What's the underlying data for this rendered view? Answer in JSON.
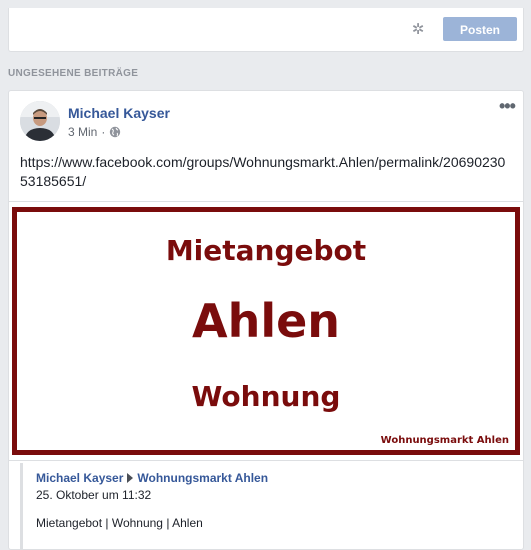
{
  "composer": {
    "settings_icon": "gear-icon",
    "post_label": "Posten"
  },
  "section_heading": "UNGESEHENE BEITRÄGE",
  "post": {
    "author": "Michael Kayser",
    "time": "3 Min",
    "separator": "·",
    "privacy_icon": "globe-icon",
    "more_icon": "more-options-icon",
    "more_symbol": "•••",
    "link": "https://www.facebook.com/groups/Wohnungsmarkt.Ahlen/permalink/2069023053185651/",
    "image": {
      "line1": "Mietangebot",
      "line2": "Ahlen",
      "line3": "Wohnung",
      "brand": "Wohnungsmarkt Ahlen",
      "accent_color": "#7a0c0c"
    },
    "shared": {
      "author": "Michael Kayser",
      "group": "Wohnungsmarkt Ahlen",
      "date": "25. Oktober um 11:32",
      "text": "Mietangebot | Wohnung | Ahlen"
    }
  },
  "colors": {
    "background": "#e9ebee",
    "link_blue": "#365899",
    "button_disabled": "#9cb4d8"
  }
}
